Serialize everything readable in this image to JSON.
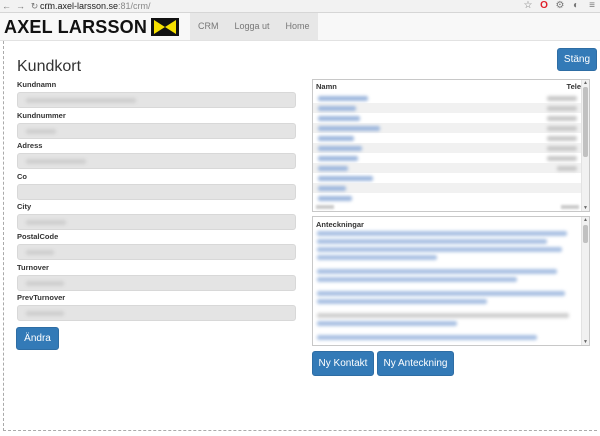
{
  "browser": {
    "url_host": "crm.axel-larsson.se",
    "url_rest": ":81/crm/"
  },
  "brand": {
    "name": "AXEL LARSSON"
  },
  "menu": [
    {
      "label": "CRM"
    },
    {
      "label": "Logga ut"
    },
    {
      "label": "Home"
    }
  ],
  "page": {
    "title": "Kundkort",
    "close_label": "Stäng",
    "edit_label": "Ändra"
  },
  "fields": [
    {
      "label": "Kundnamn"
    },
    {
      "label": "Kundnummer"
    },
    {
      "label": "Adress"
    },
    {
      "label": "Co"
    },
    {
      "label": "City"
    },
    {
      "label": "PostalCode"
    },
    {
      "label": "Turnover"
    },
    {
      "label": "PrevTurnover"
    }
  ],
  "contacts": {
    "col_name": "Namn",
    "col_phone": "Tele"
  },
  "notes": {
    "title": "Anteckningar"
  },
  "actions": {
    "new_contact": "Ny Kontakt",
    "new_note": "Ny Anteckning"
  },
  "colors": {
    "primary": "#337ab7",
    "logo_flag": "#f5e000"
  }
}
